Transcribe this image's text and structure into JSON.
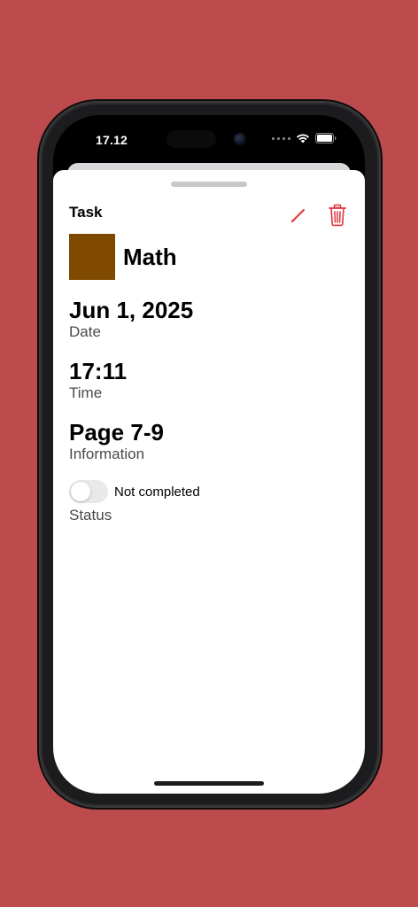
{
  "status_bar": {
    "time": "17.12",
    "icons": [
      "cellular-dots-icon",
      "wifi-icon",
      "battery-icon"
    ]
  },
  "sheet": {
    "title": "Task",
    "actions": [
      {
        "name": "edit",
        "icon": "pencil-icon",
        "color": "#e0343b"
      },
      {
        "name": "delete",
        "icon": "trash-icon",
        "color": "#e0343b"
      }
    ]
  },
  "task": {
    "subject": "Math",
    "subject_color": "#7f4a00",
    "date_value": "Jun 1, 2025",
    "date_label": "Date",
    "time_value": "17:11",
    "time_label": "Time",
    "info_value": "Page 7-9",
    "info_label": "Information",
    "status_text": "Not completed",
    "status_label": "Status",
    "completed": false
  },
  "colors": {
    "background": "#bd4b4d",
    "accent": "#e0343b"
  }
}
